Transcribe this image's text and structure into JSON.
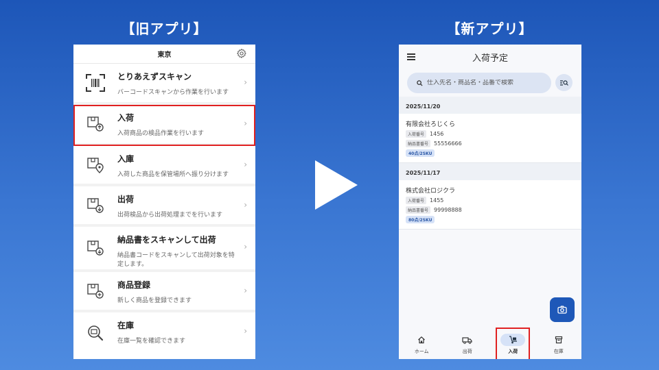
{
  "headings": {
    "old": "【旧アプリ】",
    "new": "【新アプリ】"
  },
  "old_app": {
    "header_title": "東京",
    "items": [
      {
        "title": "とりあえずスキャン",
        "desc": "バーコードスキャンから作業を行います"
      },
      {
        "title": "入荷",
        "desc": "入荷商品の検品作業を行います"
      },
      {
        "title": "入庫",
        "desc": "入荷した商品を保管場所へ振り分けます"
      },
      {
        "title": "出荷",
        "desc": "出荷検品から出荷処理までを行います"
      },
      {
        "title": "納品書をスキャンして出荷",
        "desc": "納品書コードをスキャンして出荷対象を特定します。"
      },
      {
        "title": "商品登録",
        "desc": "新しく商品を登録できます"
      },
      {
        "title": "在庫",
        "desc": "在庫一覧を確認できます"
      }
    ],
    "chevron": "›"
  },
  "new_app": {
    "title": "入荷予定",
    "search": {
      "placeholder": "仕入先名・商品名・品番で検索"
    },
    "groups": [
      {
        "date": "2025/11/20",
        "entries": [
          {
            "company": "有限会社ろじくら",
            "arrival_label": "入荷番号",
            "arrival_no": "1456",
            "delivery_label": "納品書番号",
            "delivery_no": "55556666",
            "qty": "40点/2SKU"
          }
        ]
      },
      {
        "date": "2025/11/17",
        "entries": [
          {
            "company": "株式会社ロジクラ",
            "arrival_label": "入荷番号",
            "arrival_no": "1455",
            "delivery_label": "納品書番号",
            "delivery_no": "99998888",
            "qty": "80点/2SKU"
          }
        ]
      }
    ],
    "nav": [
      {
        "label": "ホーム",
        "icon": "home-icon"
      },
      {
        "label": "出荷",
        "icon": "truck-icon"
      },
      {
        "label": "入荷",
        "icon": "dolly-icon",
        "active": true
      },
      {
        "label": "在庫",
        "icon": "box-icon"
      }
    ]
  },
  "colors": {
    "accent": "#1e58b8",
    "highlight": "#e02020"
  }
}
